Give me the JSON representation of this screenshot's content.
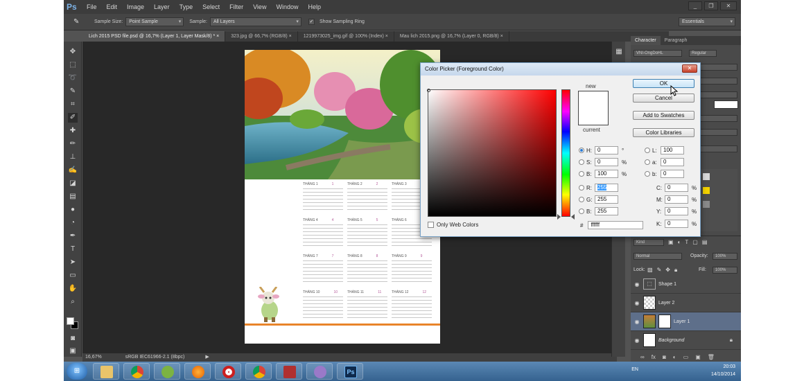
{
  "app": {
    "logo": "Ps",
    "menu": [
      "File",
      "Edit",
      "Image",
      "Layer",
      "Type",
      "Select",
      "Filter",
      "View",
      "Window",
      "Help"
    ],
    "window_controls": [
      "_",
      "❐",
      "✕"
    ]
  },
  "options": {
    "sample_size_label": "Sample Size:",
    "sample_size_value": "Point Sample",
    "sample_label": "Sample:",
    "sample_value": "All Layers",
    "show_ring_label": "Show Sampling Ring",
    "workspace": "Essentials"
  },
  "tabs": [
    "Lich 2015 PSD file.psd @ 16,7% (Layer 1, Layer Mask/8) *",
    "323.jpg @ 66,7% (RGB/8)",
    "1219973025_img.gif @ 100% (Index)",
    "Mau lich 2015.png @ 16,7% (Layer 0, RGB/8)"
  ],
  "status": {
    "zoom": "16,67%",
    "profile": "sRGB IEC61966-2.1 (8bpc)"
  },
  "calendar": {
    "months": [
      {
        "title": "THÁNG 1",
        "num": "1"
      },
      {
        "title": "THÁNG 2",
        "num": "2"
      },
      {
        "title": "THÁNG 3",
        "num": "3"
      },
      {
        "title": "THÁNG 4",
        "num": "4"
      },
      {
        "title": "THÁNG 5",
        "num": "5"
      },
      {
        "title": "THÁNG 6",
        "num": "6"
      },
      {
        "title": "THÁNG 7",
        "num": "7"
      },
      {
        "title": "THÁNG 8",
        "num": "8"
      },
      {
        "title": "THÁNG 9",
        "num": "9"
      },
      {
        "title": "THÁNG 10",
        "num": "10"
      },
      {
        "title": "THÁNG 11",
        "num": "11"
      },
      {
        "title": "THÁNG 12",
        "num": "12"
      }
    ]
  },
  "character_panel": {
    "tabs": [
      "Character",
      "Paragraph"
    ],
    "font": "VNI-OngDoHL",
    "style": "Regular"
  },
  "layers_panel": {
    "kind_label": "Kind",
    "blend_mode": "Normal",
    "opacity_label": "Opacity:",
    "opacity_value": "100%",
    "lock_label": "Lock:",
    "fill_label": "Fill:",
    "fill_value": "100%",
    "layers": [
      {
        "name": "Shape 1",
        "active": false
      },
      {
        "name": "Layer 2",
        "active": false
      },
      {
        "name": "Layer 1",
        "active": true
      },
      {
        "name": "Background",
        "active": false
      }
    ],
    "lock_icon": "lock-icon"
  },
  "color_picker": {
    "title": "Color Picker (Foreground Color)",
    "close": "✕",
    "new_label": "new",
    "current_label": "current",
    "new_color": "#ffffff",
    "buttons": {
      "ok": "OK",
      "cancel": "Cancel",
      "add_swatches": "Add to Swatches",
      "color_libraries": "Color Libraries"
    },
    "hsb": [
      {
        "label": "H:",
        "value": "0",
        "unit": "°",
        "selected": true
      },
      {
        "label": "S:",
        "value": "0",
        "unit": "%",
        "selected": false
      },
      {
        "label": "B:",
        "value": "100",
        "unit": "%",
        "selected": false
      }
    ],
    "rgb": [
      {
        "label": "R:",
        "value": "255"
      },
      {
        "label": "G:",
        "value": "255"
      },
      {
        "label": "B:",
        "value": "255"
      }
    ],
    "lab": [
      {
        "label": "L:",
        "value": "100"
      },
      {
        "label": "a:",
        "value": "0"
      },
      {
        "label": "b:",
        "value": "0"
      }
    ],
    "cmyk": [
      {
        "label": "C:",
        "value": "0",
        "unit": "%"
      },
      {
        "label": "M:",
        "value": "0",
        "unit": "%"
      },
      {
        "label": "Y:",
        "value": "0",
        "unit": "%"
      },
      {
        "label": "K:",
        "value": "0",
        "unit": "%"
      }
    ],
    "only_web_colors": "Only Web Colors",
    "hex_label": "#",
    "hex_value": "ffffff"
  },
  "taskbar": {
    "start": "⊞",
    "apps": [
      {
        "name": "explorer",
        "color": "#e9c46a"
      },
      {
        "name": "chrome",
        "color": "#db4437"
      },
      {
        "name": "coccoc",
        "color": "#7cb342"
      },
      {
        "name": "firefox",
        "color": "#e66000"
      },
      {
        "name": "opera",
        "color": "#cc1f1f"
      },
      {
        "name": "chrome2",
        "color": "#db4437"
      },
      {
        "name": "media",
        "color": "#b03030"
      },
      {
        "name": "paint",
        "color": "#9a79c8"
      }
    ],
    "ps_label": "Ps",
    "lang": "EN",
    "time": "20:03",
    "date": "14/10/2014"
  }
}
